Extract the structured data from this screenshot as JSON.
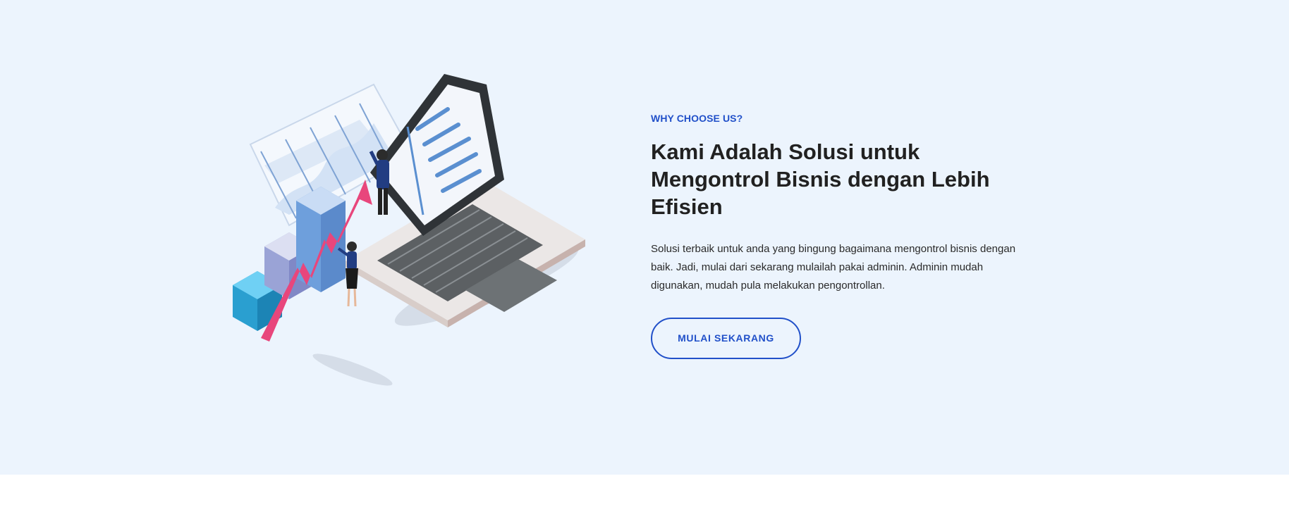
{
  "hero": {
    "eyebrow": "WHY CHOOSE US?",
    "title": "Kami Adalah Solusi untuk Mengontrol Bisnis dengan Lebih Efisien",
    "description": "Solusi terbaik untuk anda yang bingung bagaimana mengontrol bisnis dengan baik. Jadi, mulai dari sekarang mulailah pakai adminin. Adminin mudah digunakan, mudah pula melakukan pengontrollan.",
    "cta_label": "MULAI SEKARANG"
  },
  "illustration": {
    "icon": "business-analytics-illustration"
  },
  "colors": {
    "section_bg": "#ecf4fd",
    "accent": "#2150c9",
    "heading": "#212121",
    "arrow": "#e8467c"
  }
}
